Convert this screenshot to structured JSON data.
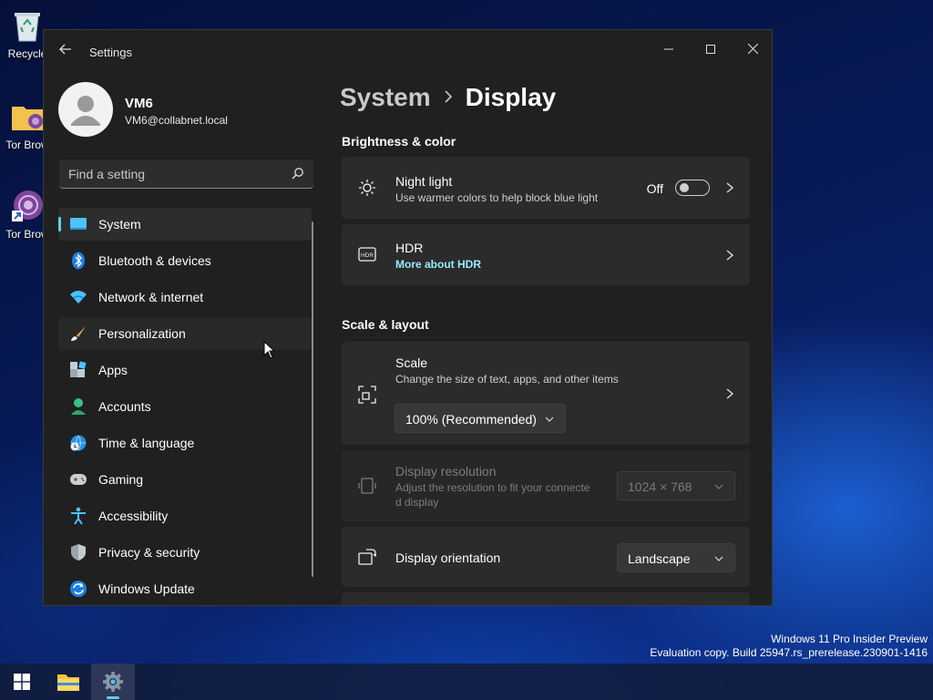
{
  "desktop": {
    "icons": [
      {
        "label": "Recycle",
        "icon": "recycle-bin-icon"
      },
      {
        "label": "Tor Brow",
        "icon": "folder-icon"
      },
      {
        "label": "Tor Brow",
        "icon": "tor-browser-icon"
      }
    ],
    "watermark": {
      "line1": "Windows 11 Pro Insider Preview",
      "line2": "Evaluation copy. Build 25947.rs_prerelease.230901-1416"
    }
  },
  "window": {
    "title": "Settings",
    "controls": [
      "minimize",
      "maximize",
      "close"
    ]
  },
  "profile": {
    "name": "VM6",
    "email": "VM6@collabnet.local"
  },
  "search": {
    "placeholder": "Find a setting"
  },
  "sidebar": {
    "items": [
      {
        "label": "System",
        "icon": "system-icon",
        "active": true
      },
      {
        "label": "Bluetooth & devices",
        "icon": "bluetooth-icon"
      },
      {
        "label": "Network & internet",
        "icon": "wifi-icon"
      },
      {
        "label": "Personalization",
        "icon": "brush-icon",
        "hover": true
      },
      {
        "label": "Apps",
        "icon": "apps-icon"
      },
      {
        "label": "Accounts",
        "icon": "person-icon"
      },
      {
        "label": "Time & language",
        "icon": "globe-clock-icon"
      },
      {
        "label": "Gaming",
        "icon": "gamepad-icon"
      },
      {
        "label": "Accessibility",
        "icon": "accessibility-icon"
      },
      {
        "label": "Privacy & security",
        "icon": "shield-icon"
      },
      {
        "label": "Windows Update",
        "icon": "update-icon"
      }
    ]
  },
  "main": {
    "breadcrumb": {
      "parent": "System",
      "current": "Display"
    },
    "sections": {
      "brightness_color": "Brightness & color",
      "scale_layout": "Scale & layout"
    },
    "night_light": {
      "title": "Night light",
      "desc": "Use warmer colors to help block blue light",
      "state": "Off"
    },
    "hdr": {
      "title": "HDR",
      "link": "More about HDR"
    },
    "scale": {
      "title": "Scale",
      "desc": "Change the size of text, apps, and other items",
      "value": "100% (Recommended)"
    },
    "resolution": {
      "title": "Display resolution",
      "desc_line1": "Adjust the resolution to fit your connecte",
      "desc_line2": "d display",
      "value": "1024 × 768"
    },
    "orientation": {
      "title": "Display orientation",
      "value": "Landscape"
    }
  },
  "taskbar": {
    "items": [
      "start-icon",
      "file-explorer-icon",
      "settings-icon"
    ],
    "active": "settings-icon"
  },
  "colors": {
    "accent": "#60cdff",
    "window_bg": "#202020",
    "card_bg": "#2b2b2b"
  }
}
